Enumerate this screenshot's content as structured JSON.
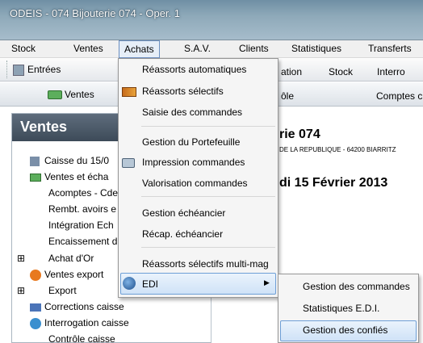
{
  "window": {
    "title": "ODEIS - 074 Bijouterie 074 - Oper. 1"
  },
  "menubar": {
    "items": [
      {
        "label": "Stock"
      },
      {
        "label": "Ventes"
      },
      {
        "label": "Achats"
      },
      {
        "label": "S.A.V."
      },
      {
        "label": "Clients"
      },
      {
        "label": "Statistiques"
      },
      {
        "label": "Transferts"
      }
    ]
  },
  "toolbar1": {
    "entrees": "Entrées",
    "ation": "ation",
    "stock": "Stock",
    "interro": "Interro"
  },
  "toolbar2": {
    "ventes": "Ventes",
    "ole": "ôle",
    "comptes": "Comptes c"
  },
  "leftpanel": {
    "title": "Ventes",
    "items": [
      {
        "label": "Caisse du 15/0"
      },
      {
        "label": "Ventes et écha"
      },
      {
        "label": "Acomptes - Cde"
      },
      {
        "label": "Rembt. avoirs e"
      },
      {
        "label": "Intégration Ech"
      },
      {
        "label": "Encaissement d"
      },
      {
        "label": "Achat d'Or"
      },
      {
        "label": "Ventes export"
      },
      {
        "label": "Export"
      },
      {
        "label": "Corrections caisse"
      },
      {
        "label": "Interrogation caisse"
      },
      {
        "label": "Contrôle caisse"
      }
    ]
  },
  "main": {
    "shop": "rie 074",
    "address": "DE LA REPUBLIQUE - 64200 BIARRITZ",
    "date": "di 15 Février 2013"
  },
  "dropdown": {
    "items": [
      {
        "label": "Réassorts automatiques"
      },
      {
        "label": "Réassorts sélectifs"
      },
      {
        "label": "Saisie des commandes"
      },
      {
        "label": "Gestion du Portefeuille"
      },
      {
        "label": "Impression commandes"
      },
      {
        "label": "Valorisation commandes"
      },
      {
        "label": "Gestion échéancier"
      },
      {
        "label": "Récap. échéancier"
      },
      {
        "label": "Réassorts sélectifs multi-mag"
      },
      {
        "label": "EDI"
      }
    ]
  },
  "submenu": {
    "items": [
      {
        "label": "Gestion des commandes"
      },
      {
        "label": "Statistiques E.D.I."
      },
      {
        "label": "Gestion des confiés"
      }
    ]
  }
}
